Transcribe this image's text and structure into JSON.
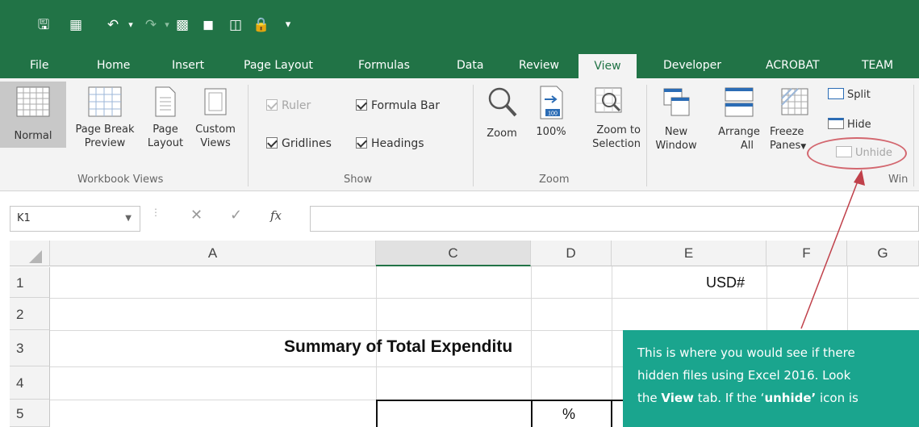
{
  "tabs": [
    "File",
    "Home",
    "Insert",
    "Page Layout",
    "Formulas",
    "Data",
    "Review",
    "View",
    "Developer",
    "ACROBAT",
    "TEAM"
  ],
  "ribbon": {
    "workbook_views": {
      "normal": "Normal",
      "page_break_1": "Page Break",
      "page_break_2": "Preview",
      "page_layout_1": "Page",
      "page_layout_2": "Layout",
      "custom_1": "Custom",
      "custom_2": "Views",
      "group_label": "Workbook Views"
    },
    "show": {
      "ruler": "Ruler",
      "formula_bar": "Formula Bar",
      "gridlines": "Gridlines",
      "headings": "Headings",
      "group_label": "Show"
    },
    "zoom": {
      "zoom": "Zoom",
      "hundred": "100%",
      "zoom_to_1": "Zoom to",
      "zoom_to_2": "Selection",
      "group_label": "Zoom"
    },
    "window": {
      "new_1": "New",
      "new_2": "Window",
      "arrange_1": "Arrange",
      "arrange_2": "All",
      "freeze_1": "Freeze",
      "freeze_2": "Panes",
      "split": "Split",
      "hide": "Hide",
      "unhide": "Unhide",
      "group_label": "Win"
    }
  },
  "formula_bar": {
    "name_box": "K1",
    "fx": "fx",
    "value": ""
  },
  "grid": {
    "columns": [
      "A",
      "C",
      "D",
      "E",
      "F",
      "G"
    ],
    "rows": [
      "1",
      "2",
      "3",
      "4",
      "5"
    ],
    "e1": "USD#",
    "title": "Summary of Total Expenditu",
    "d5": "%"
  },
  "callout": {
    "line1": "This is where you would see if there",
    "line2": "hidden files using Excel 2016.  Look",
    "line3_pre": "the ",
    "line3_view": "View",
    "line3_mid": " tab. If the ‘",
    "line3_unhide": "unhide’",
    "line3_post": " icon is"
  },
  "colors": {
    "excel_green": "#217346",
    "callout_teal": "#1aa58e",
    "annotation_red": "#c0404a"
  }
}
